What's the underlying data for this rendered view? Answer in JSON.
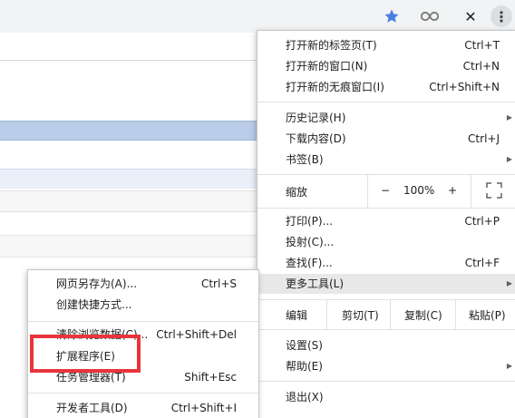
{
  "toolbar": {
    "star_icon": "bookmark-star-icon",
    "extension_icon": "infinity-extension-icon",
    "close_glyph": "✕",
    "more_glyph": "⋮"
  },
  "menu": {
    "new_tab": {
      "label": "打开新的标签页(T)",
      "shortcut": "Ctrl+T"
    },
    "new_window": {
      "label": "打开新的窗口(N)",
      "shortcut": "Ctrl+N"
    },
    "new_incognito": {
      "label": "打开新的无痕窗口(I)",
      "shortcut": "Ctrl+Shift+N"
    },
    "history": {
      "label": "历史记录(H)"
    },
    "downloads": {
      "label": "下载内容(D)",
      "shortcut": "Ctrl+J"
    },
    "bookmarks": {
      "label": "书签(B)"
    },
    "zoom": {
      "label": "缩放",
      "minus": "−",
      "value": "100%",
      "plus": "+"
    },
    "print": {
      "label": "打印(P)...",
      "shortcut": "Ctrl+P"
    },
    "cast": {
      "label": "投射(C)..."
    },
    "find": {
      "label": "查找(F)...",
      "shortcut": "Ctrl+F"
    },
    "more_tools": {
      "label": "更多工具(L)"
    },
    "edit": {
      "label": "编辑",
      "cut": "剪切(T)",
      "copy": "复制(C)",
      "paste": "粘贴(P)"
    },
    "settings": {
      "label": "设置(S)"
    },
    "help": {
      "label": "帮助(E)"
    },
    "exit": {
      "label": "退出(X)"
    }
  },
  "submenu": {
    "save_page": {
      "label": "网页另存为(A)...",
      "shortcut": "Ctrl+S"
    },
    "create_shortcut": {
      "label": "创建快捷方式..."
    },
    "clear_data": {
      "label": "清除浏览数据(C)...",
      "shortcut": "Ctrl+Shift+Del"
    },
    "extensions": {
      "label": "扩展程序(E)"
    },
    "task_manager": {
      "label": "任务管理器(T)",
      "shortcut": "Shift+Esc"
    },
    "dev_tools": {
      "label": "开发者工具(D)",
      "shortcut": "Ctrl+Shift+I"
    }
  },
  "colors": {
    "accent_star": "#4a7fe0",
    "highlight_box": "#e8353b",
    "selected_row": "#b9cde8"
  }
}
